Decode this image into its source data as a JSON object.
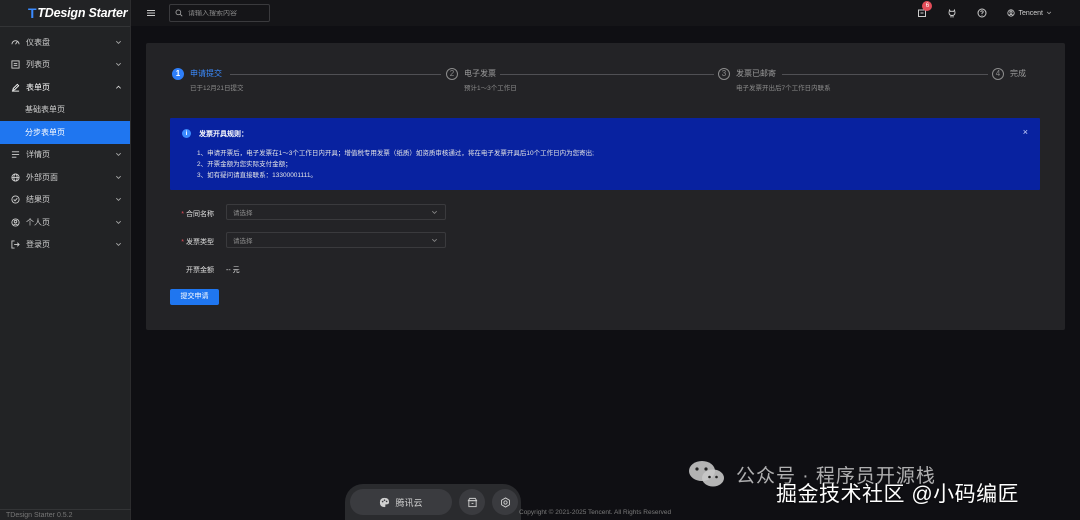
{
  "app": {
    "logo_mark": "T",
    "logo_text": "TDesign Starter",
    "version": "TDesign Starter 0.5.2"
  },
  "sidebar": {
    "items": [
      {
        "label": "仪表盘",
        "icon": "dashboard-icon",
        "expanded": false
      },
      {
        "label": "列表页",
        "icon": "list-icon",
        "expanded": false
      },
      {
        "label": "表单页",
        "icon": "edit-icon",
        "expanded": true,
        "children": [
          {
            "label": "基础表单页",
            "active": false
          },
          {
            "label": "分步表单页",
            "active": true
          }
        ]
      },
      {
        "label": "详情页",
        "icon": "detail-icon",
        "expanded": false
      },
      {
        "label": "外部页面",
        "icon": "globe-icon",
        "expanded": false
      },
      {
        "label": "结果页",
        "icon": "check-circle-icon",
        "expanded": false
      },
      {
        "label": "个人页",
        "icon": "user-icon",
        "expanded": false
      },
      {
        "label": "登录页",
        "icon": "logout-icon",
        "expanded": false
      }
    ]
  },
  "header": {
    "search_placeholder": "请输入搜索内容",
    "notification_count": "6",
    "user_name": "Tencent"
  },
  "steps": [
    {
      "number": "1",
      "title": "申请提交",
      "desc": "已于12月21日提交",
      "status": "process"
    },
    {
      "number": "2",
      "title": "电子发票",
      "desc": "预计1～3个工作日",
      "status": "wait"
    },
    {
      "number": "3",
      "title": "发票已邮寄",
      "desc": "电子发票开出后7个工作日内联系",
      "status": "wait"
    },
    {
      "number": "4",
      "title": "完成",
      "desc": "",
      "status": "wait"
    }
  ],
  "alert": {
    "title": "发票开具规则：",
    "lines": [
      "1、申请开票后，电子发票在1～3个工作日内开具；增值税专用发票（纸质）如资质审核通过，将在电子发票开具后10个工作日内为您寄出;",
      "2、开票金额为您实际支付金额；",
      "3、如有疑问请直接联系：13300001111。"
    ],
    "close": "×"
  },
  "form": {
    "contract_label": "合同名称",
    "contract_placeholder": "请选择",
    "invoice_type_label": "发票类型",
    "invoice_type_placeholder": "请选择",
    "amount_label": "开票金额",
    "amount_value": "-- 元",
    "required_mark": "*",
    "submit_label": "提交申请"
  },
  "floatbar": {
    "pill_label": "腾讯云"
  },
  "footer": {
    "copyright": "Copyright © 2021-2025 Tencent. All Rights Reserved"
  },
  "watermark": {
    "top": "公众号 · 程序员开源栈",
    "bottom": "掘金技术社区 @小码编匠"
  },
  "colors": {
    "primary": "#1f76f0",
    "alert_bg": "#0822a0",
    "badge": "#e34d59",
    "card": "#232326",
    "sidebar": "#222325"
  }
}
